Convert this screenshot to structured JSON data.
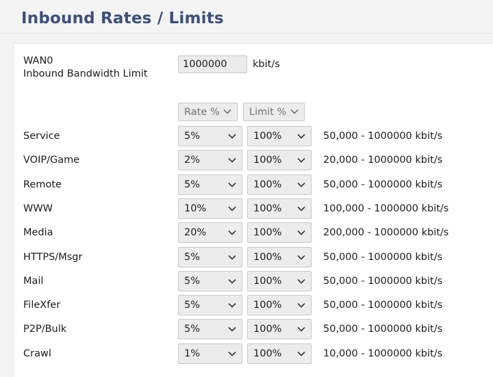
{
  "page": {
    "title": "Inbound Rates / Limits"
  },
  "wan": {
    "name": "WAN0",
    "label": "Inbound Bandwidth Limit",
    "value": "1000000",
    "unit": "kbit/s"
  },
  "headers": {
    "rate": "Rate %",
    "limit": "Limit %"
  },
  "rows": [
    {
      "name": "Service",
      "rate": "5%",
      "limit": "100%",
      "range": "50,000 - 1000000 kbit/s"
    },
    {
      "name": "VOIP/Game",
      "rate": "2%",
      "limit": "100%",
      "range": "20,000 - 1000000 kbit/s"
    },
    {
      "name": "Remote",
      "rate": "5%",
      "limit": "100%",
      "range": "50,000 - 1000000 kbit/s"
    },
    {
      "name": "WWW",
      "rate": "10%",
      "limit": "100%",
      "range": "100,000 - 1000000 kbit/s"
    },
    {
      "name": "Media",
      "rate": "20%",
      "limit": "100%",
      "range": "200,000 - 1000000 kbit/s"
    },
    {
      "name": "HTTPS/Msgr",
      "rate": "5%",
      "limit": "100%",
      "range": "50,000 - 1000000 kbit/s"
    },
    {
      "name": "Mail",
      "rate": "5%",
      "limit": "100%",
      "range": "50,000 - 1000000 kbit/s"
    },
    {
      "name": "FileXfer",
      "rate": "5%",
      "limit": "100%",
      "range": "50,000 - 1000000 kbit/s"
    },
    {
      "name": "P2P/Bulk",
      "rate": "5%",
      "limit": "100%",
      "range": "50,000 - 1000000 kbit/s"
    },
    {
      "name": "Crawl",
      "rate": "1%",
      "limit": "100%",
      "range": "10,000 - 1000000 kbit/s"
    }
  ]
}
